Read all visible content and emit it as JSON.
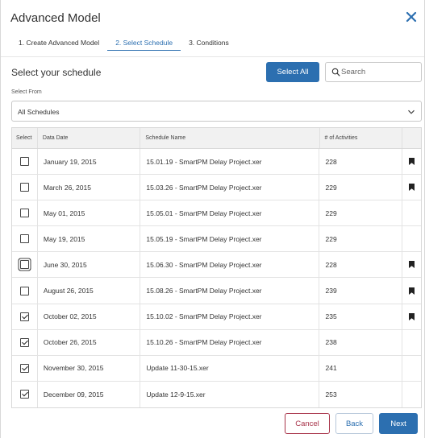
{
  "dialog": {
    "title": "Advanced Model",
    "close_icon": "close-icon"
  },
  "steps": [
    {
      "label": "1.  Create Advanced Model",
      "active": false
    },
    {
      "label": "2.  Select Schedule",
      "active": true
    },
    {
      "label": "3.  Conditions",
      "active": false
    }
  ],
  "section": {
    "title": "Select your schedule",
    "select_all_label": "Select All"
  },
  "search": {
    "placeholder": "Search",
    "value": "",
    "icon": "search-icon"
  },
  "select_from": {
    "label": "Select From",
    "value": "All Schedules",
    "icon": "chevron-down-icon"
  },
  "table": {
    "headers": [
      "Select",
      "Data Date",
      "Schedule Name",
      "# of Activities",
      ""
    ],
    "rows": [
      {
        "checked": false,
        "focused": false,
        "date": "January 19, 2015",
        "name": "15.01.19 - SmartPM Delay Project.xer",
        "activities": "228",
        "bookmark": true
      },
      {
        "checked": false,
        "focused": false,
        "date": "March 26, 2015",
        "name": "15.03.26 - SmartPM Delay Project.xer",
        "activities": "229",
        "bookmark": true
      },
      {
        "checked": false,
        "focused": false,
        "date": "May 01, 2015",
        "name": "15.05.01 - SmartPM Delay Project.xer",
        "activities": "229",
        "bookmark": false
      },
      {
        "checked": false,
        "focused": false,
        "date": "May 19, 2015",
        "name": "15.05.19 - SmartPM Delay Project.xer",
        "activities": "229",
        "bookmark": false
      },
      {
        "checked": false,
        "focused": true,
        "date": "June 30, 2015",
        "name": "15.06.30 - SmartPM Delay Project.xer",
        "activities": "228",
        "bookmark": true
      },
      {
        "checked": false,
        "focused": false,
        "date": "August 26, 2015",
        "name": "15.08.26 - SmartPM Delay Project.xer",
        "activities": "239",
        "bookmark": true
      },
      {
        "checked": true,
        "focused": false,
        "date": "October 02, 2015",
        "name": "15.10.02 - SmartPM Delay Project.xer",
        "activities": "235",
        "bookmark": true
      },
      {
        "checked": true,
        "focused": false,
        "date": "October 26, 2015",
        "name": "15.10.26 - SmartPM Delay Project.xer",
        "activities": "238",
        "bookmark": false
      },
      {
        "checked": true,
        "focused": false,
        "date": "November 30, 2015",
        "name": "Update 11-30-15.xer",
        "activities": "241",
        "bookmark": false
      },
      {
        "checked": true,
        "focused": false,
        "date": "December 09, 2015",
        "name": "Update 12-9-15.xer",
        "activities": "253",
        "bookmark": false
      }
    ]
  },
  "footer": {
    "cancel_label": "Cancel",
    "back_label": "Back",
    "next_label": "Next"
  },
  "colors": {
    "accent": "#2c6fb0",
    "cancel": "#a8344a"
  }
}
